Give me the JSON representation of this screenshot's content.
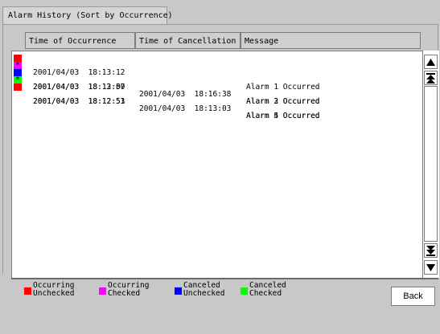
{
  "tab_title": "Alarm History (Sort by Occurrence)",
  "columns": {
    "occurrence": "Time of Occurrence",
    "cancellation": "Time of Cancellation",
    "message": "Message"
  },
  "rows": [
    {
      "status": "occurring-unchecked",
      "color": "#ff0000",
      "mark": "",
      "occurred": "2001/04/03  18:13:12",
      "canceled": "",
      "message": "Alarm 1 Occurred"
    },
    {
      "status": "occurring-checked",
      "color": "#ff00ff",
      "mark": "*",
      "occurred": "2001/04/03  18:13:00",
      "canceled": "2001/04/03  18:16:38",
      "message": "Alarm 2 Occurred"
    },
    {
      "status": "canceled-unchecked",
      "color": "#0000ff",
      "mark": "",
      "occurred": "2001/04/03  18:12:57",
      "canceled": "",
      "message": "Alarm 3 Occurred"
    },
    {
      "status": "canceled-checked",
      "color": "#00ff00",
      "mark": "*",
      "occurred": "2001/04/03  18:12:53",
      "canceled": "2001/04/03  18:13:03",
      "message": "Alarm 4 Occurred"
    },
    {
      "status": "occurring-unchecked",
      "color": "#ff0000",
      "mark": "",
      "occurred": "2001/04/03  18:12:51",
      "canceled": "",
      "message": "Alarm 5 Occurred"
    }
  ],
  "scroll_buttons": {
    "up": "up-arrow-icon",
    "page_up": "double-up-arrow-icon",
    "page_down": "double-down-arrow-icon",
    "down": "down-arrow-icon"
  },
  "legend": [
    {
      "color": "#ff0000",
      "label": "Occurring\nUnchecked"
    },
    {
      "color": "#ff00ff",
      "label": "Occurring\nChecked"
    },
    {
      "color": "#0000ff",
      "label": "Canceled\nUnchecked"
    },
    {
      "color": "#00ff00",
      "label": "Canceled\nChecked"
    }
  ],
  "back_label": "Back"
}
